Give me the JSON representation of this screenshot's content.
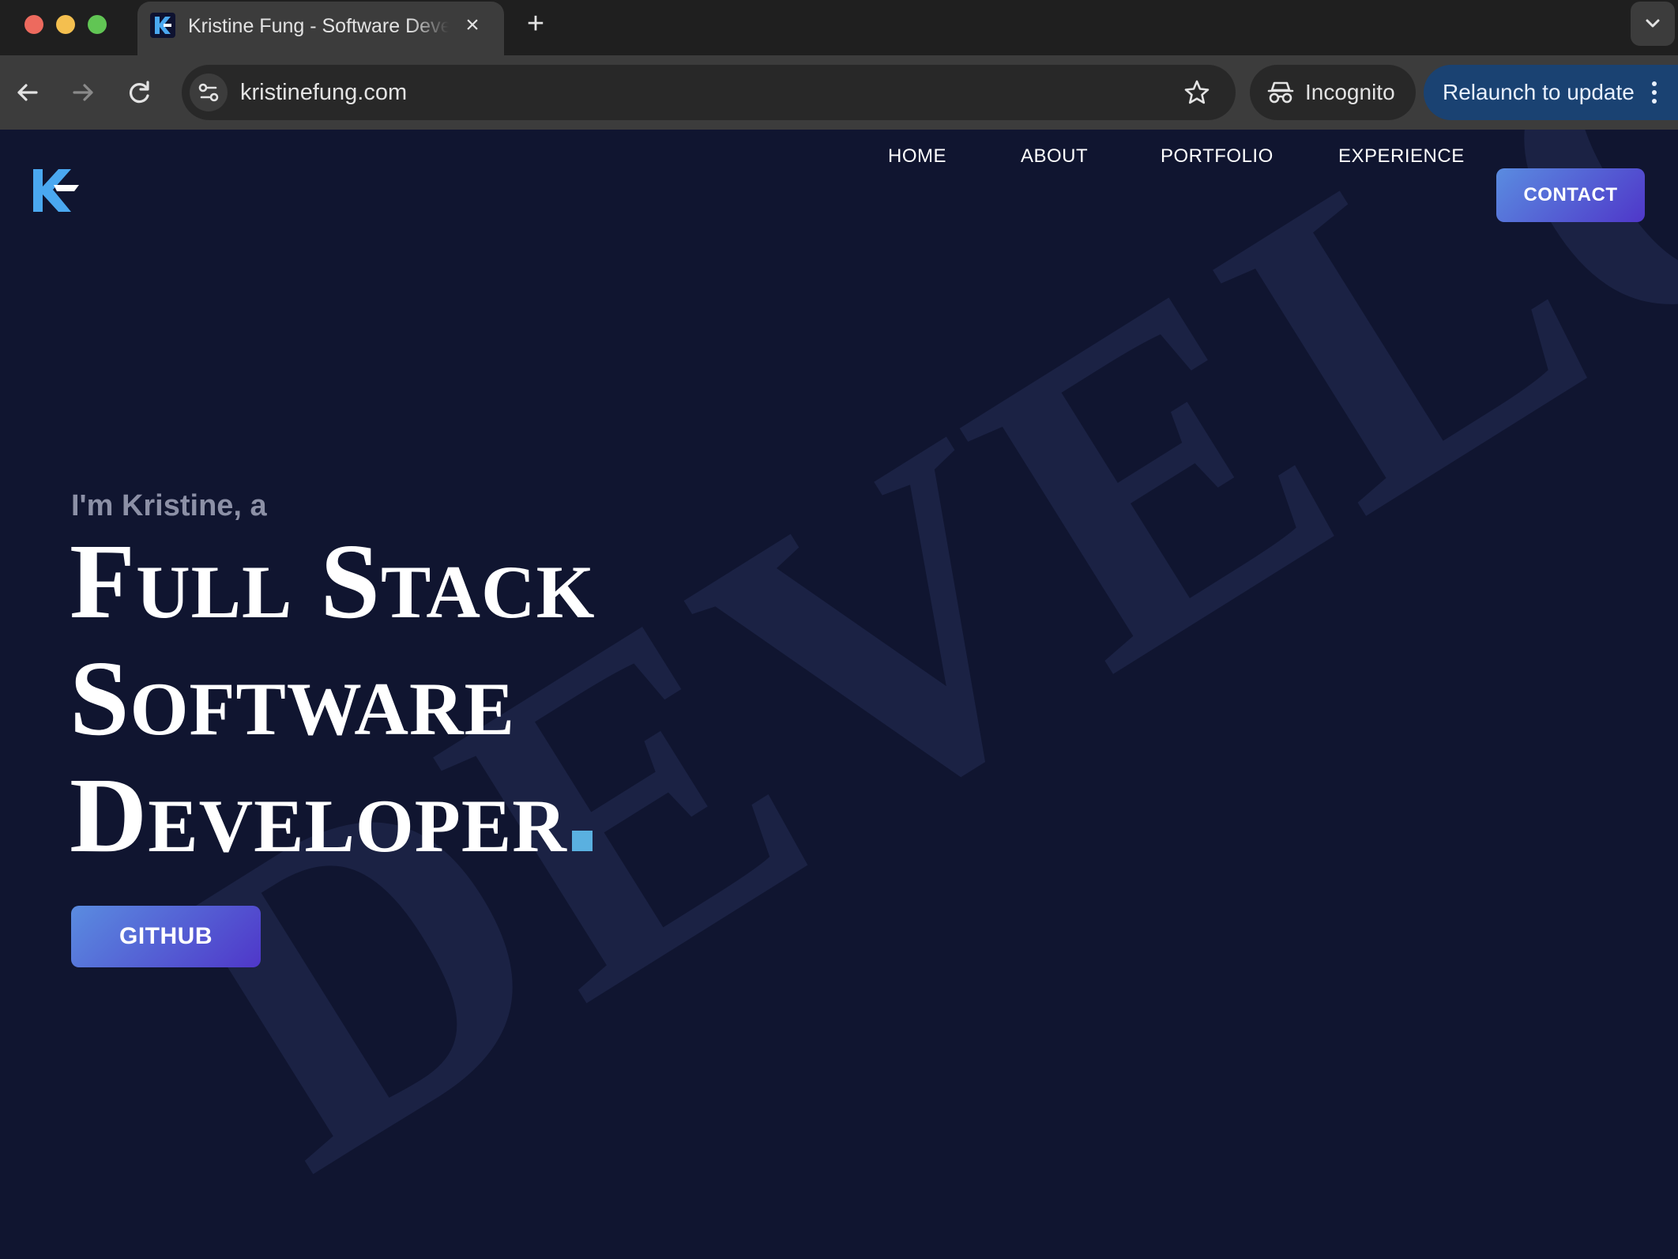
{
  "browser": {
    "tab_title": "Kristine Fung - Software Developer",
    "url": "kristinefung.com",
    "incognito_label": "Incognito",
    "relaunch_label": "Relaunch to update"
  },
  "site": {
    "nav": {
      "home": "HOME",
      "about": "ABOUT",
      "portfolio": "PORTFOLIO",
      "experience": "EXPERIENCE",
      "contact": "CONTACT"
    },
    "hero": {
      "intro": "I'm Kristine, a",
      "line1": "Full Stack",
      "line2": "Software",
      "line3": "Developer",
      "watermark": "DEVELOPER",
      "github_button": "GITHUB"
    }
  },
  "icons": {
    "back": "arrow-left-icon",
    "forward": "arrow-right-icon",
    "reload": "reload-icon",
    "site_info": "tune-icon",
    "bookmark": "star-icon",
    "incognito": "incognito-icon",
    "menu": "kebab-menu-icon",
    "tab_search": "chevron-down-icon"
  },
  "colors": {
    "page_background": "#101530",
    "accent_gradient_start": "#5a8ce0",
    "accent_gradient_end": "#4f37c9",
    "headline_dot": "#5ab0e0",
    "logo_blue": "#4aa8f0"
  }
}
